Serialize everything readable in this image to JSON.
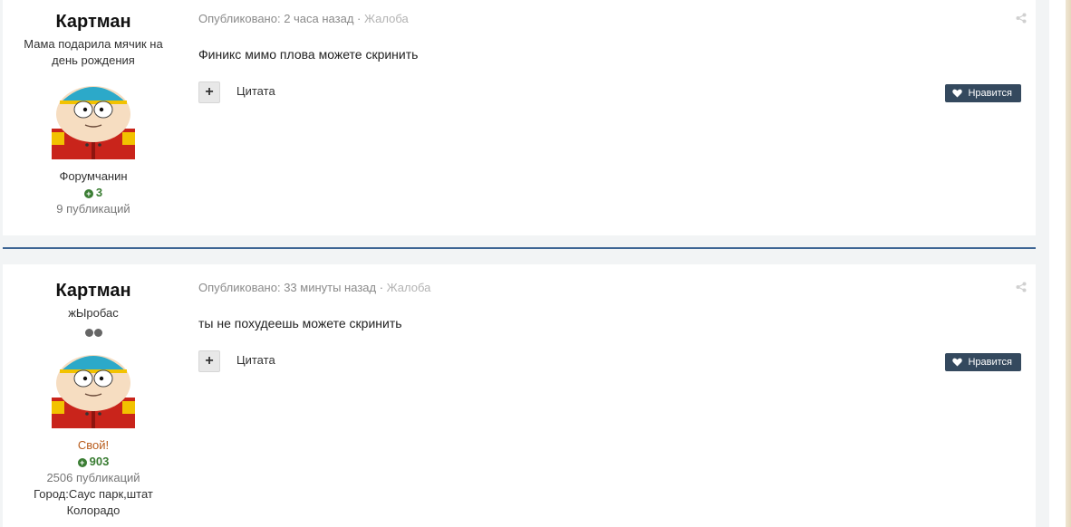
{
  "posts": [
    {
      "author": {
        "name": "Картман",
        "title": "Мама подарила мячик на день рождения",
        "group": "Форумчанин",
        "reputation": "3",
        "post_count": "9 публикаций"
      },
      "meta": {
        "published": "Опубликовано: 2 часа назад",
        "separator": " · ",
        "report": "Жалоба"
      },
      "content": "Финикс мимо плова можете скринить",
      "actions": {
        "quote": "Цитата",
        "like": "Нравится",
        "multiquote": "+"
      },
      "icons": {
        "share": "share-icon",
        "like": "heart-icon",
        "reputation": "plus-circle-icon"
      }
    },
    {
      "author": {
        "name": "Картман",
        "title": "жЫробас",
        "group": "Свой!",
        "reputation": "903",
        "post_count": "2506 публикаций",
        "city": "Город:Саус парк,штат Колорадо"
      },
      "meta": {
        "published": "Опубликовано: 33 минуты назад",
        "separator": " · ",
        "report": "Жалоба"
      },
      "content": "ты не похудеешь можете скринить",
      "actions": {
        "quote": "Цитата",
        "like": "Нравится",
        "multiquote": "+"
      },
      "icons": {
        "share": "share-icon",
        "like": "heart-icon",
        "reputation": "plus-circle-icon"
      }
    }
  ],
  "colors": {
    "like_button": "#34495e",
    "reputation": "#3a7d33",
    "own_group": "#b85c1c",
    "separator": "#3d6594"
  }
}
